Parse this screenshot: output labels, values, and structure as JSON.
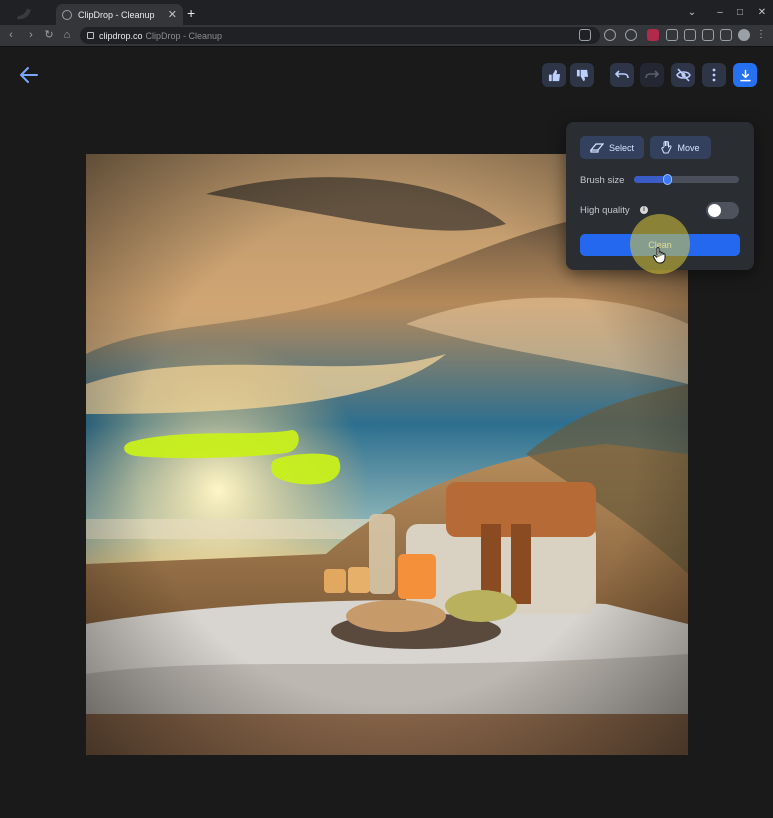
{
  "browser": {
    "tab_title": "ClipDrop - Cleanup",
    "tab_close": "✕",
    "new_tab": "+",
    "url_domain": "clipdrop.co",
    "url_path": "ClipDrop - Cleanup",
    "window_controls": [
      "⌄",
      "–",
      "□",
      "✕"
    ]
  },
  "toolbar": {
    "icons": [
      "back-arrow-icon",
      "thumbs-up-icon",
      "thumbs-down-icon",
      "undo-icon",
      "redo-icon",
      "hide-icon",
      "more-icon",
      "download-icon"
    ]
  },
  "panel": {
    "select_label": "Select",
    "move_label": "Move",
    "brush_size_label": "Brush size",
    "brush_size_value": 0.3,
    "high_quality_label": "High quality",
    "high_quality_on": false,
    "clean_label": "Clean"
  },
  "colors": {
    "accent": "#2670f2",
    "background": "#1a1a1b",
    "mask": "#c8f01a"
  }
}
